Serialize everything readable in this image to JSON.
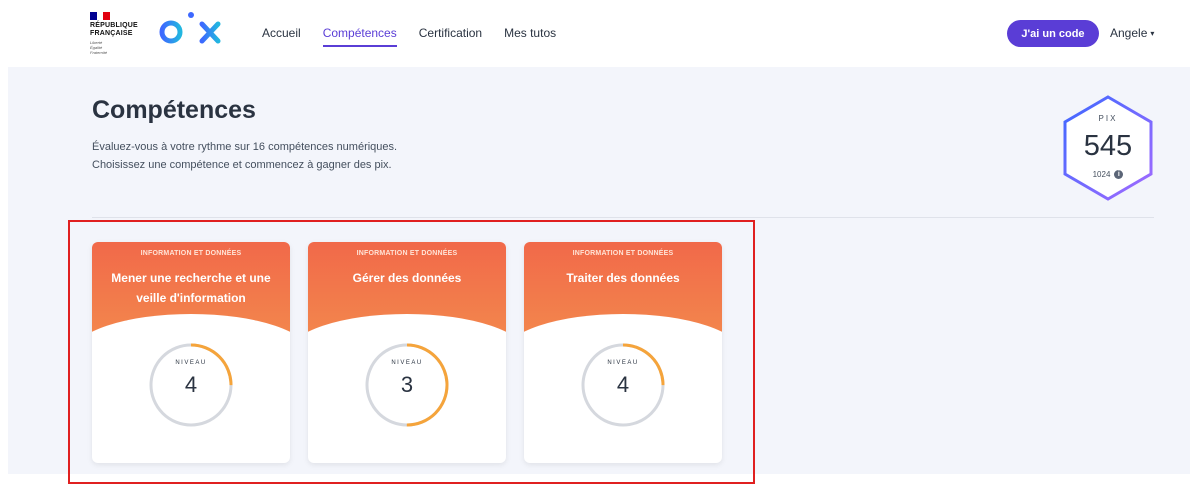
{
  "header": {
    "gov_logo": {
      "name": "RÉPUBLIQUE\nFRANÇAISE",
      "motto": "Liberté\nÉgalité\nFraternité"
    },
    "brand_logo": "pix",
    "nav": [
      {
        "label": "Accueil",
        "active": false
      },
      {
        "label": "Compétences",
        "active": true
      },
      {
        "label": "Certification",
        "active": false
      },
      {
        "label": "Mes tutos",
        "active": false
      }
    ],
    "code_button": "J'ai un code",
    "user_name": "Angele",
    "user_menu_icon": "caret-down-icon"
  },
  "page": {
    "title": "Compétences",
    "description_line1": "Évaluez-vous à votre rythme sur 16 compétences numériques.",
    "description_line2": "Choisissez une compétence et commencez à gagner des pix."
  },
  "pix_score": {
    "label": "PIX",
    "value": "545",
    "max": "1024",
    "info_icon": "info-icon"
  },
  "cards": [
    {
      "area": "INFORMATION ET DONNÉES",
      "name": "Mener une recherche et une veille d'information",
      "level_label": "NIVEAU",
      "level": "4",
      "progress": 0.25
    },
    {
      "area": "INFORMATION ET DONNÉES",
      "name": "Gérer des données",
      "level_label": "NIVEAU",
      "level": "3",
      "progress": 0.5
    },
    {
      "area": "INFORMATION ET DONNÉES",
      "name": "Traiter des données",
      "level_label": "NIVEAU",
      "level": "4",
      "progress": 0.25
    }
  ],
  "colors": {
    "primary": "#5a3dd6",
    "card_gradient_start": "#f1694a",
    "card_gradient_end": "#f3874c",
    "level_progress": "#f5a43b",
    "level_track": "#d5d8de",
    "highlight_border": "#e02020"
  }
}
